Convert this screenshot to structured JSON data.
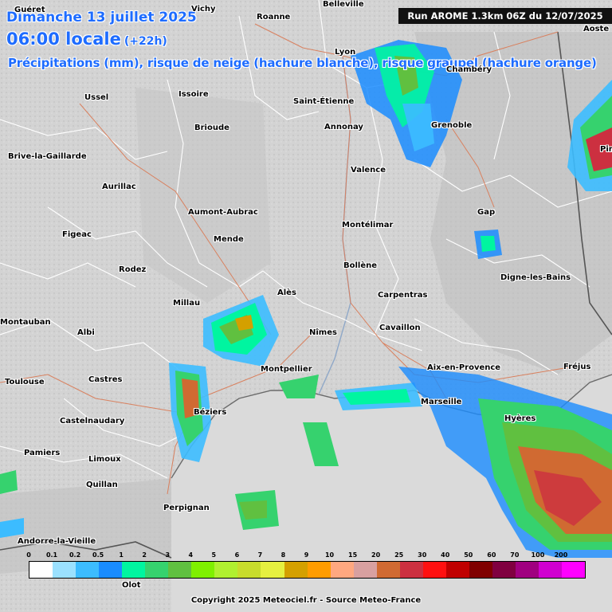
{
  "header": {
    "date": "Dimanche 13 juillet 2025",
    "time": "06:00 locale",
    "offset": "(+22h)",
    "description": "Précipitations (mm), risque de neige (hachure blanche), risque graupel (hachure orange)",
    "run": "Run AROME 1.3km 06Z du 12/07/2025"
  },
  "copyright": "Copyright 2025 Meteociel.fr - Source Meteo-France",
  "colors": {
    "land": "#d4d4d4",
    "sea": "#d9d9d9",
    "border": "#ffffff",
    "road": "#d97a5c",
    "title": "#1e6cff"
  },
  "legend": {
    "labels": [
      "0",
      "0.1",
      "0.2",
      "0.5",
      "1",
      "2",
      "3",
      "4",
      "5",
      "6",
      "7",
      "8",
      "9",
      "10",
      "15",
      "20",
      "25",
      "30",
      "40",
      "50",
      "60",
      "70",
      "100",
      "200"
    ],
    "colors": [
      "#ffffff",
      "#9be1ff",
      "#3cbcff",
      "#1a8cff",
      "#00f5a0",
      "#36d26e",
      "#60c040",
      "#7ff000",
      "#b0f030",
      "#c8dc2c",
      "#e6f040",
      "#d4a000",
      "#ff9c00",
      "#ffa880",
      "#d8a0a0",
      "#d06a32",
      "#cc3040",
      "#ff1010",
      "#c00000",
      "#800000",
      "#800040",
      "#a00080",
      "#d000d0",
      "#ff00ff"
    ]
  },
  "cities": [
    {
      "name": "Guéret"
    },
    {
      "name": "Vichy"
    },
    {
      "name": "Roanne"
    },
    {
      "name": "Belleville"
    },
    {
      "name": "Ussel"
    },
    {
      "name": "Issoire"
    },
    {
      "name": "Lyon"
    },
    {
      "name": "Chambéry"
    },
    {
      "name": "Aoste"
    },
    {
      "name": "Brioude"
    },
    {
      "name": "Saint-Étienne"
    },
    {
      "name": "Annonay"
    },
    {
      "name": "Grenoble"
    },
    {
      "name": "Brive-la-Gaillarde"
    },
    {
      "name": "Valence"
    },
    {
      "name": "Aurillac"
    },
    {
      "name": "Aumont-Aubrac"
    },
    {
      "name": "Gap"
    },
    {
      "name": "Figeac"
    },
    {
      "name": "Mende"
    },
    {
      "name": "Montélimar"
    },
    {
      "name": "Bollène"
    },
    {
      "name": "Rodez"
    },
    {
      "name": "Digne-les-Bains"
    },
    {
      "name": "Millau"
    },
    {
      "name": "Alès"
    },
    {
      "name": "Carpentras"
    },
    {
      "name": "Montauban"
    },
    {
      "name": "Albi"
    },
    {
      "name": "Nîmes"
    },
    {
      "name": "Cavaillon"
    },
    {
      "name": "Toulouse"
    },
    {
      "name": "Castres"
    },
    {
      "name": "Montpellier"
    },
    {
      "name": "Aix-en-Provence"
    },
    {
      "name": "Fréjus"
    },
    {
      "name": "Marseille"
    },
    {
      "name": "Béziers"
    },
    {
      "name": "Hyères"
    },
    {
      "name": "Castelnaudary"
    },
    {
      "name": "Pamiers"
    },
    {
      "name": "Limoux"
    },
    {
      "name": "Quillan"
    },
    {
      "name": "Perpignan"
    },
    {
      "name": "Andorre-la-Vieille"
    },
    {
      "name": "Olot"
    },
    {
      "name": "Pin"
    }
  ]
}
